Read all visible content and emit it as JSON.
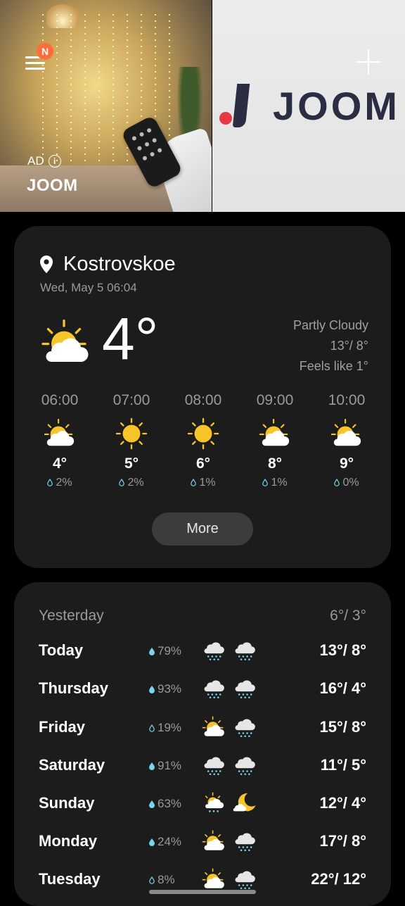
{
  "ad": {
    "badge": "N",
    "label": "AD",
    "info_glyph": "i",
    "brand": "JOOM",
    "logo_text": "JOOM"
  },
  "current": {
    "location": "Kostrovskoe",
    "datetime": "Wed, May 5 06:04",
    "temperature": "4°",
    "condition": "Partly Cloudy",
    "high_low": "13°/ 8°",
    "feels_like": "Feels like 1°",
    "icon": "partly-cloudy-icon"
  },
  "hourly": [
    {
      "time": "06:00",
      "temp": "4°",
      "precip": "2%",
      "icon": "partly-cloudy-icon"
    },
    {
      "time": "07:00",
      "temp": "5°",
      "precip": "2%",
      "icon": "sunny-icon"
    },
    {
      "time": "08:00",
      "temp": "6°",
      "precip": "1%",
      "icon": "sunny-icon"
    },
    {
      "time": "09:00",
      "temp": "8°",
      "precip": "1%",
      "icon": "partly-cloudy-icon"
    },
    {
      "time": "10:00",
      "temp": "9°",
      "precip": "0%",
      "icon": "partly-cloudy-icon"
    }
  ],
  "more_label": "More",
  "yesterday": {
    "label": "Yesterday",
    "temps": "6°/ 3°"
  },
  "daily": [
    {
      "day": "Today",
      "precip": "79%",
      "icons": [
        "rain-cloud-icon",
        "rain-cloud-icon"
      ],
      "temps": "13°/ 8°"
    },
    {
      "day": "Thursday",
      "precip": "93%",
      "icons": [
        "rain-cloud-icon",
        "rain-cloud-icon"
      ],
      "temps": "16°/ 4°"
    },
    {
      "day": "Friday",
      "precip": "19%",
      "icons": [
        "partly-cloudy-icon",
        "rain-cloud-icon"
      ],
      "temps": "15°/ 8°"
    },
    {
      "day": "Saturday",
      "precip": "91%",
      "icons": [
        "rain-cloud-icon",
        "rain-cloud-icon"
      ],
      "temps": "11°/ 5°"
    },
    {
      "day": "Sunday",
      "precip": "63%",
      "icons": [
        "sun-rain-icon",
        "moon-cloud-icon"
      ],
      "temps": "12°/ 4°"
    },
    {
      "day": "Monday",
      "precip": "24%",
      "icons": [
        "partly-cloudy-icon",
        "rain-cloud-icon"
      ],
      "temps": "17°/ 8°"
    },
    {
      "day": "Tuesday",
      "precip": "8%",
      "icons": [
        "partly-cloudy-icon",
        "rain-cloud-icon"
      ],
      "temps": "22°/ 12°"
    }
  ],
  "colors": {
    "sun": "#f7c529",
    "cloud": "#ffffff",
    "rain": "#7ad3f0",
    "card": "#1c1c1c"
  }
}
